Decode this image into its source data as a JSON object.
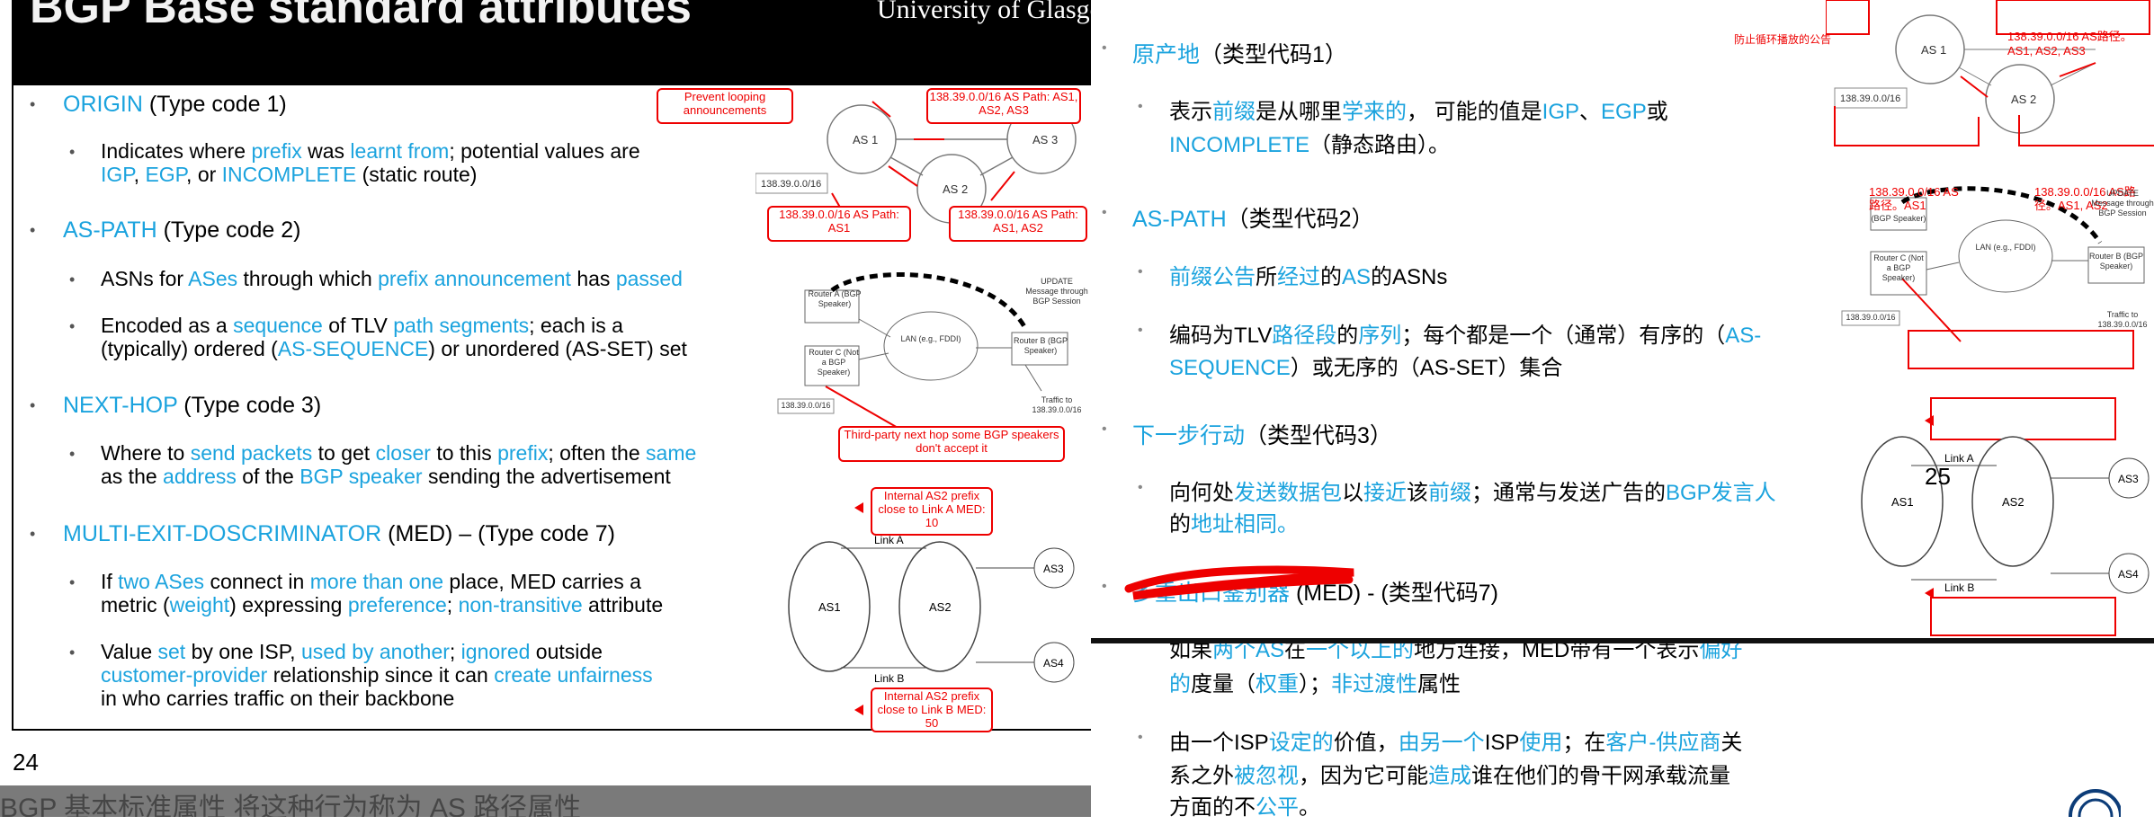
{
  "left": {
    "title": "BGP Base standard attributes",
    "logo": "University of Glasgow",
    "page_number": "24",
    "bottom_strip": "BGP 基本标准属性 将这种行为称为 AS 路径属性",
    "items": [
      {
        "parts": [
          [
            "ORIGIN",
            1
          ],
          [
            " (Type code 1)",
            0
          ]
        ]
      },
      {
        "parts": [
          [
            "Indicates where ",
            0
          ],
          [
            "prefix",
            1
          ],
          [
            " was ",
            0
          ],
          [
            "learnt from",
            1
          ],
          [
            "; potential values are",
            0
          ]
        ]
      },
      {
        "parts": [
          [
            "IGP",
            1
          ],
          [
            ", ",
            0
          ],
          [
            "EGP",
            1
          ],
          [
            ", or ",
            0
          ],
          [
            "INCOMPLETE",
            1
          ],
          [
            " (static route)",
            0
          ]
        ]
      },
      {
        "parts": [
          [
            "AS-PATH",
            1
          ],
          [
            " (Type code 2)",
            0
          ]
        ]
      },
      {
        "parts": [
          [
            "ASNs for ",
            0
          ],
          [
            "ASes",
            1
          ],
          [
            " through which ",
            0
          ],
          [
            "prefix announcement",
            1
          ],
          [
            " has ",
            0
          ],
          [
            "passed",
            1
          ]
        ]
      },
      {
        "parts": [
          [
            "Encoded as a ",
            0
          ],
          [
            "sequence",
            1
          ],
          [
            " of TLV ",
            0
          ],
          [
            "path segments",
            1
          ],
          [
            "; each is a",
            0
          ]
        ]
      },
      {
        "parts": [
          [
            "(typically) ordered (",
            0
          ],
          [
            "AS-SEQUENCE",
            1
          ],
          [
            ") or unordered (AS-SET) set",
            0
          ]
        ]
      },
      {
        "parts": [
          [
            "NEXT-HOP",
            1
          ],
          [
            " (Type code 3)",
            0
          ]
        ]
      },
      {
        "parts": [
          [
            "Where to ",
            0
          ],
          [
            "send packets",
            1
          ],
          [
            " to get ",
            0
          ],
          [
            "closer",
            1
          ],
          [
            " to this ",
            0
          ],
          [
            "prefix",
            1
          ],
          [
            "; often the ",
            0
          ],
          [
            "same",
            1
          ]
        ]
      },
      {
        "parts": [
          [
            "as the ",
            0
          ],
          [
            "address",
            1
          ],
          [
            " of the ",
            0
          ],
          [
            "BGP speaker",
            1
          ],
          [
            " sending the advertisement",
            0
          ]
        ]
      },
      {
        "parts": [
          [
            "MULTI-EXIT-DOSCRIMINATOR",
            1
          ],
          [
            " (MED) – (Type code 7)",
            0
          ]
        ]
      },
      {
        "parts": [
          [
            "If ",
            0
          ],
          [
            "two ASes",
            1
          ],
          [
            " connect in ",
            0
          ],
          [
            "more than one",
            1
          ],
          [
            " place, MED carries a",
            0
          ]
        ]
      },
      {
        "parts": [
          [
            "metric (",
            0
          ],
          [
            "weight",
            1
          ],
          [
            ") expressing ",
            0
          ],
          [
            "preference",
            1
          ],
          [
            "; ",
            0
          ],
          [
            "non-transitive",
            1
          ],
          [
            " attribute",
            0
          ]
        ]
      },
      {
        "parts": [
          [
            "Value ",
            0
          ],
          [
            "set",
            1
          ],
          [
            " by one ISP, ",
            0
          ],
          [
            "used by another",
            1
          ],
          [
            "; ",
            0
          ],
          [
            "ignored",
            1
          ],
          [
            " outside",
            0
          ]
        ]
      },
      {
        "parts": [
          [
            "customer-provider",
            1
          ],
          [
            " relationship since it can ",
            0
          ],
          [
            "create unfairness",
            1
          ]
        ]
      },
      {
        "parts": [
          [
            "in who carries traffic on their backbone",
            0
          ]
        ]
      }
    ],
    "diagram": {
      "as1": "AS 1",
      "as2": "AS 2",
      "as3": "AS 3",
      "prefix": "138.39.0.0/16",
      "prevent_looping": "Prevent looping announcements",
      "path_as1_as2_as3": "138.39.0.0/16 AS Path: AS1, AS2, AS3",
      "path_as1": "138.39.0.0/16 AS Path: AS1",
      "path_as1_as2": "138.39.0.0/16 AS Path: AS1, AS2",
      "router_a": "Router A (BGP Speaker)",
      "router_c": "Router C (Not a BGP Speaker)",
      "router_b": "Router B (BGP Speaker)",
      "lan": "LAN (e.g., FDDI)",
      "update": "UPDATE Message through BGP Session",
      "traffic": "Traffic to 138.39.0.0/16",
      "third_party": "Third-party next hop some BGP speakers don't accept it",
      "med_a": "Internal AS2 prefix close to Link A MED: 10",
      "med_b": "Internal AS2 prefix close to Link B MED: 50",
      "link_a": "Link A",
      "link_b": "Link B",
      "m_as1": "AS1",
      "m_as2": "AS2",
      "m_as3": "AS3",
      "m_as4": "AS4"
    }
  },
  "right": {
    "page_number": "25",
    "items": [
      {
        "parts": [
          [
            "原产地",
            1
          ],
          [
            "（类型代码1）",
            0
          ]
        ]
      },
      {
        "parts": [
          [
            "表示",
            0
          ],
          [
            "前缀",
            1
          ],
          [
            "是从哪里",
            0
          ],
          [
            "学来的",
            1
          ],
          [
            "， 可能的值是",
            0
          ],
          [
            "IGP",
            1
          ],
          [
            "、",
            0
          ],
          [
            "EGP",
            1
          ],
          [
            "或",
            0
          ]
        ]
      },
      {
        "parts": [
          [
            "INCOMPLETE",
            1
          ],
          [
            "（静态路由）。",
            0
          ]
        ]
      },
      {
        "parts": [
          [
            "AS-PATH",
            1
          ],
          [
            "（类型代码2）",
            0
          ]
        ]
      },
      {
        "parts": [
          [
            "前缀公告",
            1
          ],
          [
            "所",
            0
          ],
          [
            "经过",
            1
          ],
          [
            "的",
            0
          ],
          [
            "AS",
            1
          ],
          [
            "的ASNs",
            0
          ]
        ]
      },
      {
        "parts": [
          [
            "编码为TLV",
            0
          ],
          [
            "路径段",
            1
          ],
          [
            "的",
            0
          ],
          [
            "序列",
            1
          ],
          [
            "；每个都是一个（通常）有序的（",
            0
          ],
          [
            "AS-",
            1
          ]
        ]
      },
      {
        "parts": [
          [
            "SEQUENCE",
            1
          ],
          [
            "）或无序的（AS-SET）集合",
            0
          ]
        ]
      },
      {
        "parts": [
          [
            "下一步行动",
            1
          ],
          [
            "（类型代码3）",
            0
          ]
        ]
      },
      {
        "parts": [
          [
            "向何处",
            0
          ],
          [
            "发送数据包",
            1
          ],
          [
            "以",
            0
          ],
          [
            "接近",
            1
          ],
          [
            "该",
            0
          ],
          [
            "前缀",
            1
          ],
          [
            "；通常与发送广告的",
            0
          ],
          [
            "BGP发言人",
            1
          ]
        ]
      },
      {
        "parts": [
          [
            "的",
            0
          ],
          [
            "地址相同。",
            1
          ]
        ]
      },
      {
        "parts": [
          [
            "多重出口鉴别器",
            1
          ],
          [
            " (MED) - (类型代码7)",
            0
          ]
        ]
      },
      {
        "parts": [
          [
            "如果",
            0
          ],
          [
            "两个AS",
            1
          ],
          [
            "在",
            0
          ],
          [
            "一个以上的",
            1
          ],
          [
            "地方连接，MED带有一个表示",
            0
          ],
          [
            "偏好",
            1
          ]
        ]
      },
      {
        "parts": [
          [
            "的",
            1
          ],
          [
            "度量（",
            0
          ],
          [
            "权重",
            1
          ],
          [
            "）；",
            0
          ],
          [
            "非过渡性",
            1
          ],
          [
            "属性",
            0
          ]
        ]
      },
      {
        "parts": [
          [
            "由一个ISP",
            0
          ],
          [
            "设定的",
            1
          ],
          [
            "价值，",
            0
          ],
          [
            "由另一个",
            1
          ],
          [
            "ISP",
            0
          ],
          [
            "使用",
            1
          ],
          [
            "；在",
            0
          ],
          [
            "客户-供应商",
            1
          ],
          [
            "关",
            0
          ]
        ]
      },
      {
        "parts": [
          [
            "系之外",
            0
          ],
          [
            "被忽视",
            1
          ],
          [
            "，因为它可能",
            0
          ],
          [
            "造成",
            1
          ],
          [
            "谁在他们的骨干网承载流量",
            0
          ]
        ]
      },
      {
        "parts": [
          [
            "方面的不",
            0
          ],
          [
            "公平",
            1
          ],
          [
            "。",
            0
          ]
        ]
      }
    ],
    "diagram": {
      "prevent_looping": "防止循环播放的公告",
      "as1": "AS 1",
      "as2": "AS 2",
      "prefix": "138.39.0.0/16",
      "path_full": "138.39.0.0/16 AS路径。AS1, AS2, AS3",
      "path_as1": "138.39.0.0/16 AS路径。AS1",
      "path_as1_as2": "138.39.0.0/16 AS路径。AS1, AS2",
      "router_c": "Router C (Not a BGP Speaker)",
      "router_b": "Router B (BGP Speaker)",
      "bgp_speaker": "(BGP Speaker)",
      "lan": "LAN (e.g., FDDI)",
      "update": "UPDATE Message through BGP Session",
      "traffic": "Traffic to 138.39.0.0/16",
      "link_a": "Link A",
      "link_b": "Link B",
      "m_as1": "AS1",
      "m_as2": "AS2",
      "m_as3": "AS3",
      "m_as4": "AS4"
    }
  }
}
